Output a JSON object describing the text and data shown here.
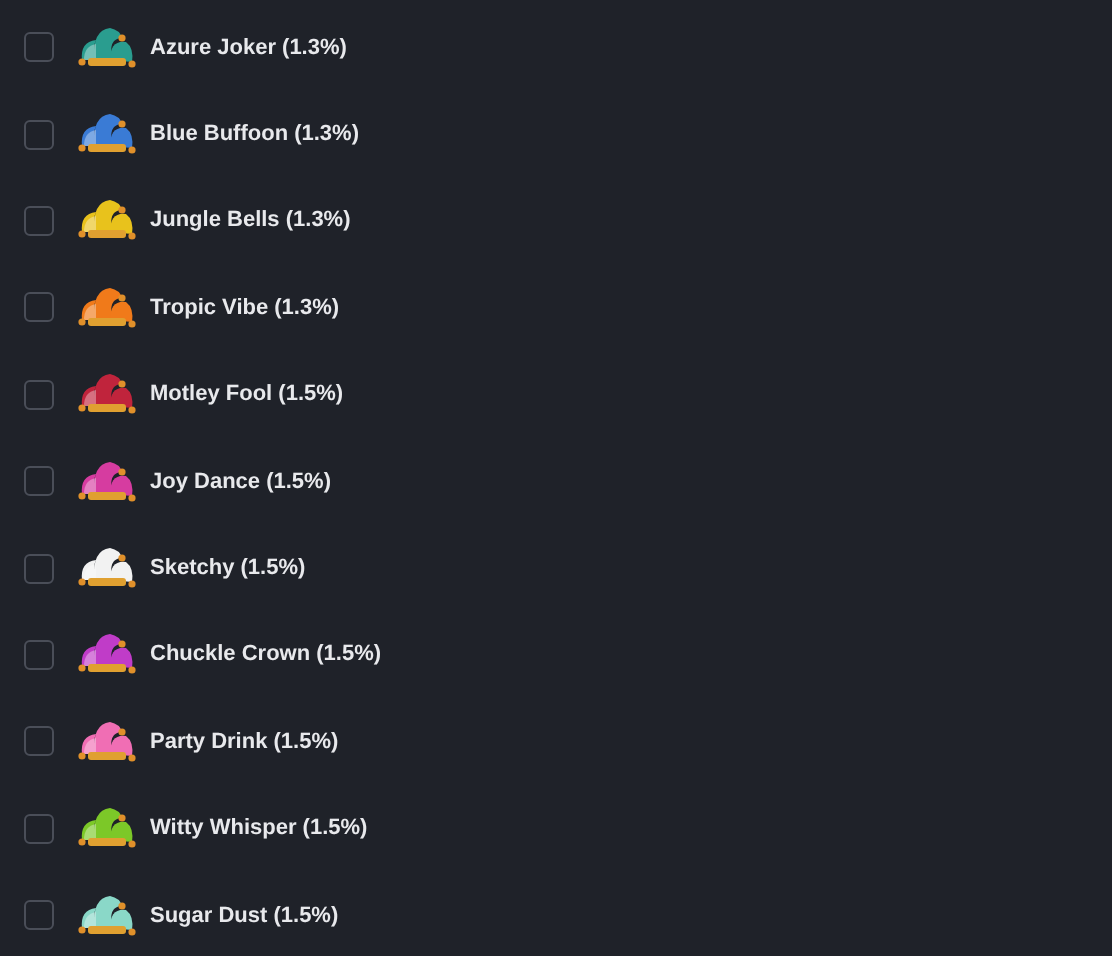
{
  "items": [
    {
      "label": "Azure Joker (1.3%)",
      "checked": false,
      "color": "#2a9d8f"
    },
    {
      "label": "Blue Buffoon (1.3%)",
      "checked": false,
      "color": "#3a7bd5"
    },
    {
      "label": "Jungle Bells (1.3%)",
      "checked": false,
      "color": "#e8c21c"
    },
    {
      "label": "Tropic Vibe (1.3%)",
      "checked": false,
      "color": "#f07a1a"
    },
    {
      "label": "Motley Fool (1.5%)",
      "checked": false,
      "color": "#c0243c"
    },
    {
      "label": "Joy Dance (1.5%)",
      "checked": false,
      "color": "#d63ca0"
    },
    {
      "label": "Sketchy (1.5%)",
      "checked": false,
      "color": "#f2f2f2"
    },
    {
      "label": "Chuckle Crown (1.5%)",
      "checked": false,
      "color": "#c03cc8"
    },
    {
      "label": "Party Drink (1.5%)",
      "checked": false,
      "color": "#f06eb4"
    },
    {
      "label": "Witty Whisper (1.5%)",
      "checked": false,
      "color": "#7cc828"
    },
    {
      "label": "Sugar Dust (1.5%)",
      "checked": false,
      "color": "#8ad8c8"
    }
  ]
}
